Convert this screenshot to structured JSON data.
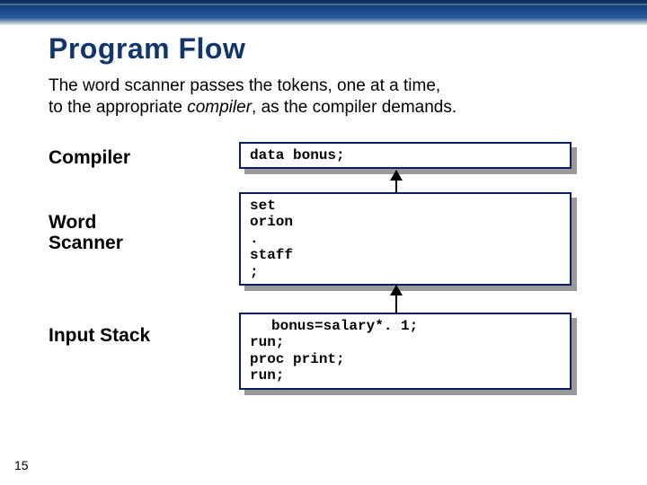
{
  "page_number": "15",
  "title": "Program Flow",
  "body_line1": "The word scanner passes the tokens, one at a time,",
  "body_line2a": "to the appropriate ",
  "body_line2b_em": "compiler",
  "body_line2c": ", as the compiler demands.",
  "labels": {
    "compiler": "Compiler",
    "scanner1": "Word",
    "scanner2": "Scanner",
    "input": "Input Stack"
  },
  "code": {
    "compiler": "data bonus;",
    "scanner": "set\norion\n.\nstaff\n;",
    "input_indent": "bonus=salary*. 1;",
    "input_rest": "run;\nproc print;\nrun;"
  }
}
